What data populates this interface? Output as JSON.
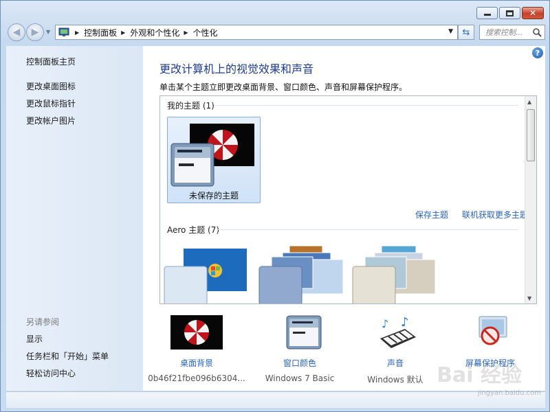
{
  "window": {
    "minimize_label": "—",
    "close_label": "✕"
  },
  "address": {
    "crumbs": [
      "控制面板",
      "外观和个性化",
      "个性化"
    ],
    "search_placeholder": "搜索控制..."
  },
  "sidebar": {
    "home": "控制面板主页",
    "links": [
      "更改桌面图标",
      "更改鼠标指针",
      "更改帐户图片"
    ],
    "see_also_title": "另请参阅",
    "see_also": [
      "显示",
      "任务栏和「开始」菜单",
      "轻松访问中心"
    ]
  },
  "main": {
    "help": "?",
    "title": "更改计算机上的视觉效果和声音",
    "subtitle": "单击某个主题立即更改桌面背景、窗口颜色、声音和屏幕保护程序。",
    "my_themes_header": "我的主题 (1)",
    "unsaved_theme_label": "未保存的主题",
    "save_theme_link": "保存主题",
    "more_themes_link": "联机获取更多主题",
    "aero_header": "Aero 主题 (7)"
  },
  "bottom": [
    {
      "label": "桌面背景",
      "value": "0b46f21fbe096b6304..."
    },
    {
      "label": "窗口颜色",
      "value": "Windows 7 Basic"
    },
    {
      "label": "声音",
      "value": "Windows 默认"
    },
    {
      "label": "屏幕保护程序",
      "value": ""
    }
  ],
  "watermark": {
    "logo": "Bai 经验",
    "url": "jingyan.baidu.com"
  },
  "colors": {
    "link": "#2b64b8",
    "title": "#1d3d8f",
    "selected_tile": "#cfe2f7"
  }
}
